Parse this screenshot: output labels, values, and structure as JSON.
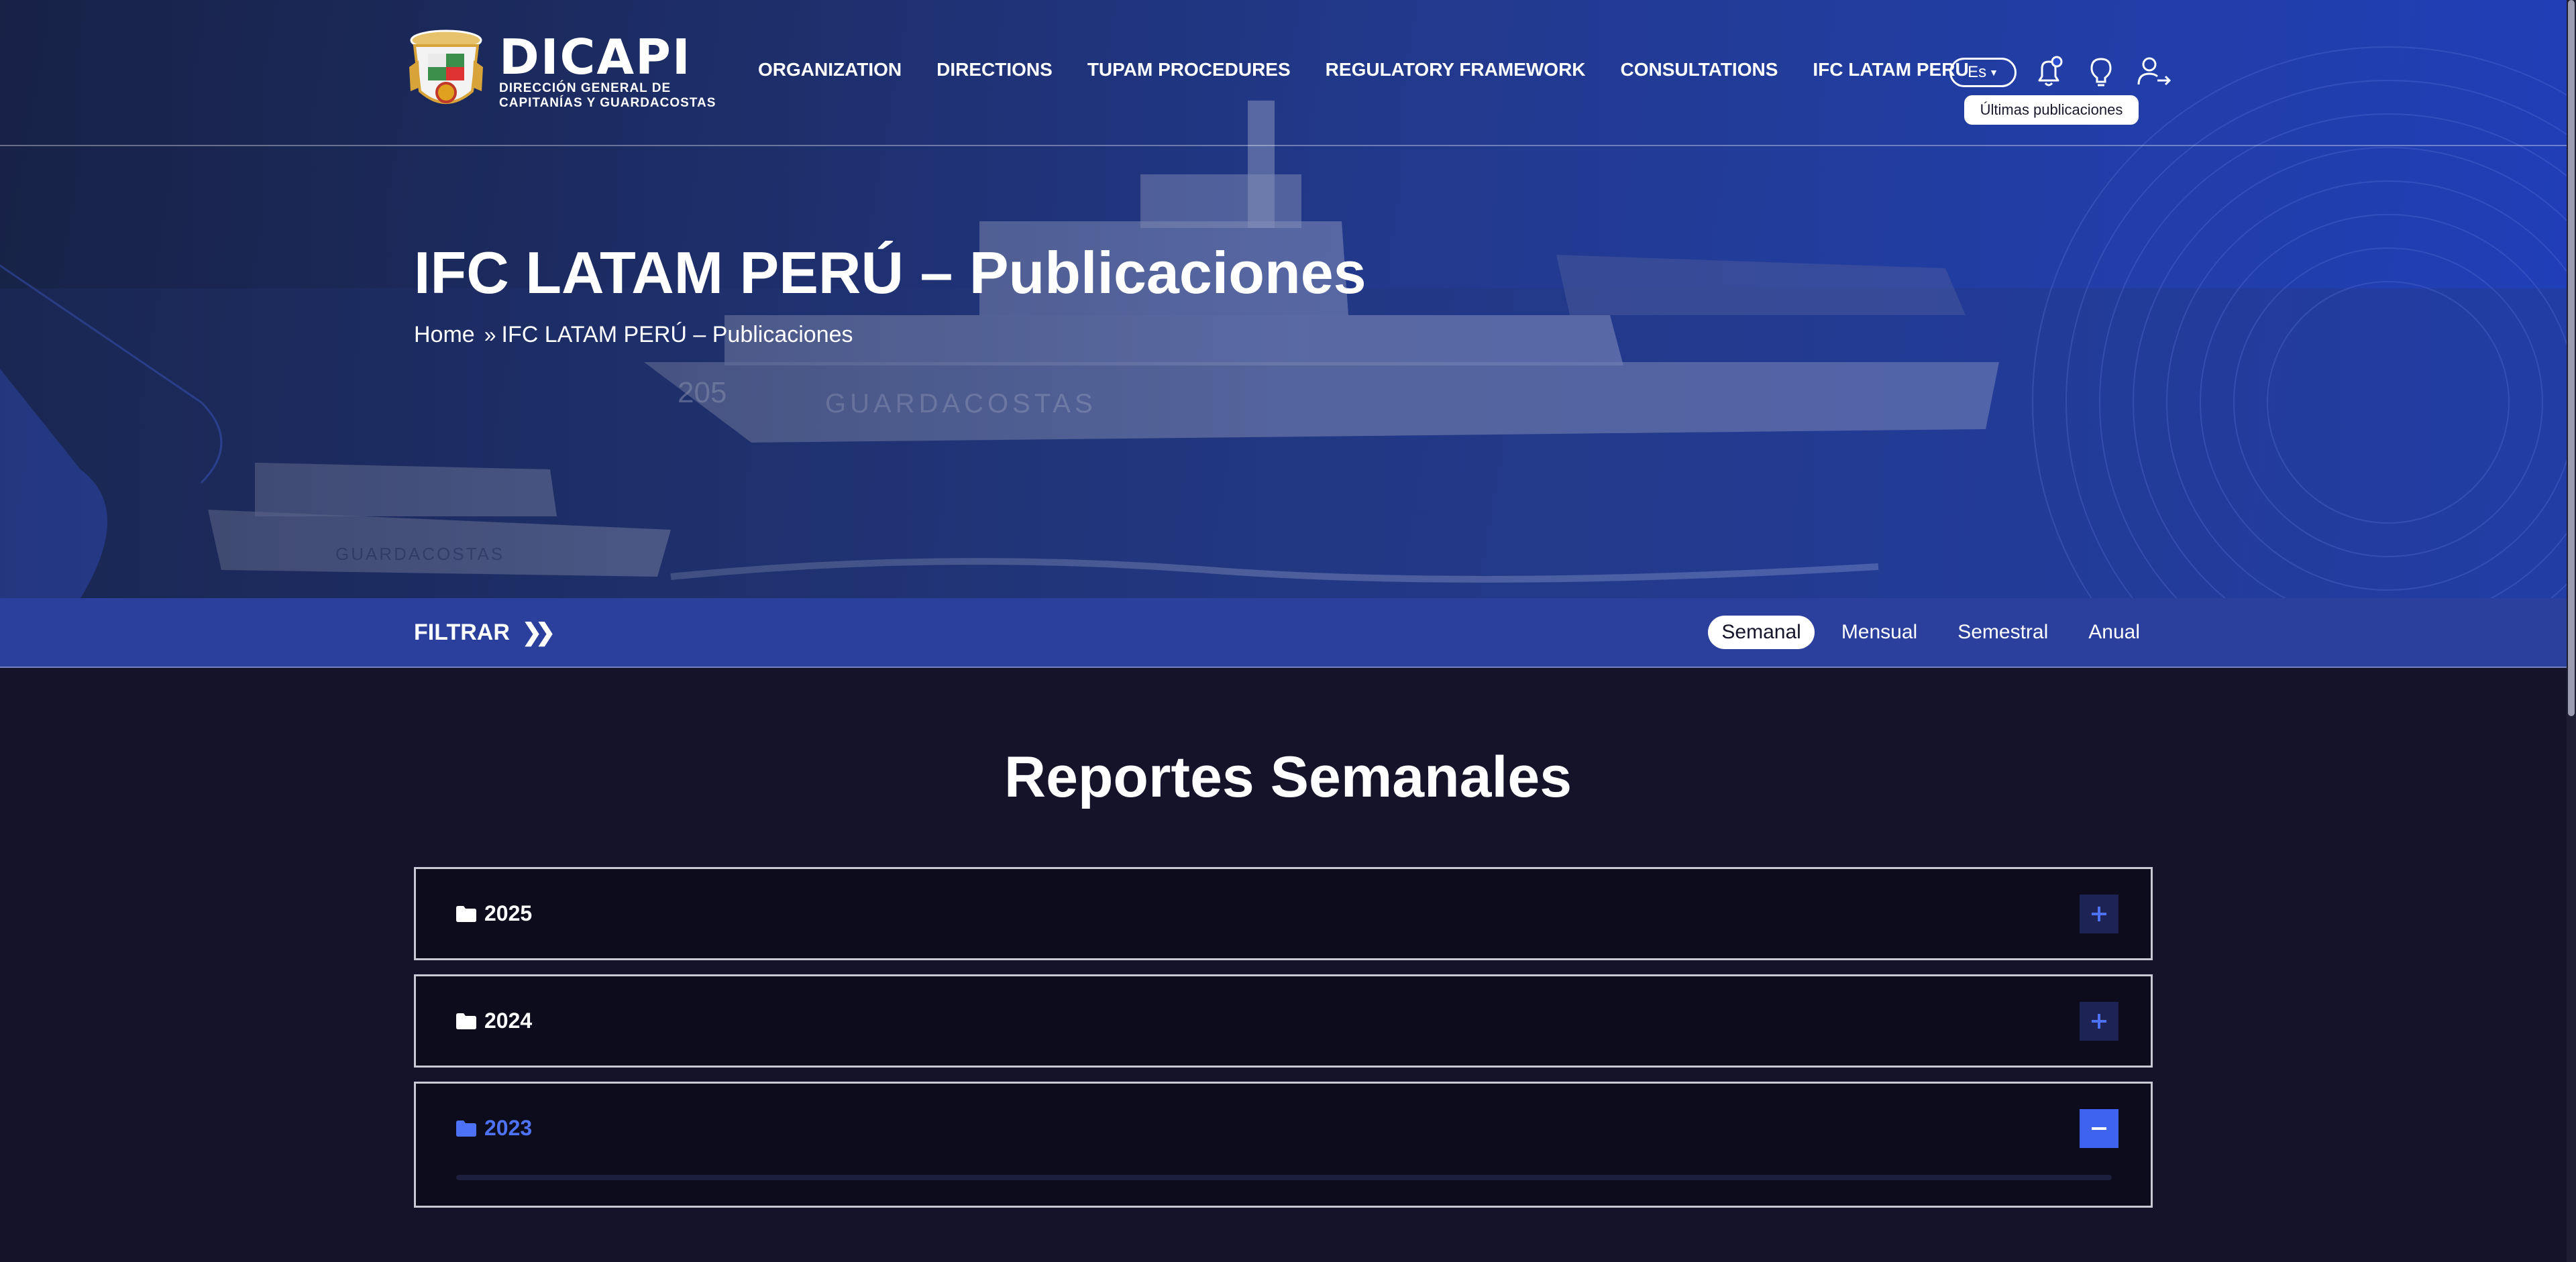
{
  "header": {
    "logo_name": "DICAPI",
    "logo_sub_1": "Dirección General de",
    "logo_sub_2": "Capitanías y Guardacostas",
    "nav": [
      {
        "label": "ORGANIZATION"
      },
      {
        "label": "DIRECTIONS"
      },
      {
        "label": "TUPAM PROCEDURES"
      },
      {
        "label": "REGULATORY FRAMEWORK"
      },
      {
        "label": "CONSULTATIONS"
      },
      {
        "label": "IFC LATAM PERU"
      }
    ],
    "language": "Es",
    "tooltip": "Últimas publicaciones",
    "icons": [
      "bell-icon",
      "lightbulb-icon",
      "user-logout-icon"
    ]
  },
  "hero": {
    "title": "IFC LATAM PERÚ – Publicaciones",
    "breadcrumb": {
      "home": "Home",
      "current": "IFC LATAM PERÚ – Publicaciones"
    }
  },
  "filter": {
    "label": "FILTRAR",
    "tabs": [
      {
        "label": "Semanal",
        "active": true
      },
      {
        "label": "Mensual",
        "active": false
      },
      {
        "label": "Semestral",
        "active": false
      },
      {
        "label": "Anual",
        "active": false
      }
    ]
  },
  "content": {
    "title": "Reportes Semanales",
    "years": [
      {
        "year": "2025",
        "open": false
      },
      {
        "year": "2024",
        "open": false
      },
      {
        "year": "2023",
        "open": true
      }
    ]
  },
  "colors": {
    "background": "#14132a",
    "accent": "#3e63ee",
    "filter_bar": "#2b3f9c"
  }
}
